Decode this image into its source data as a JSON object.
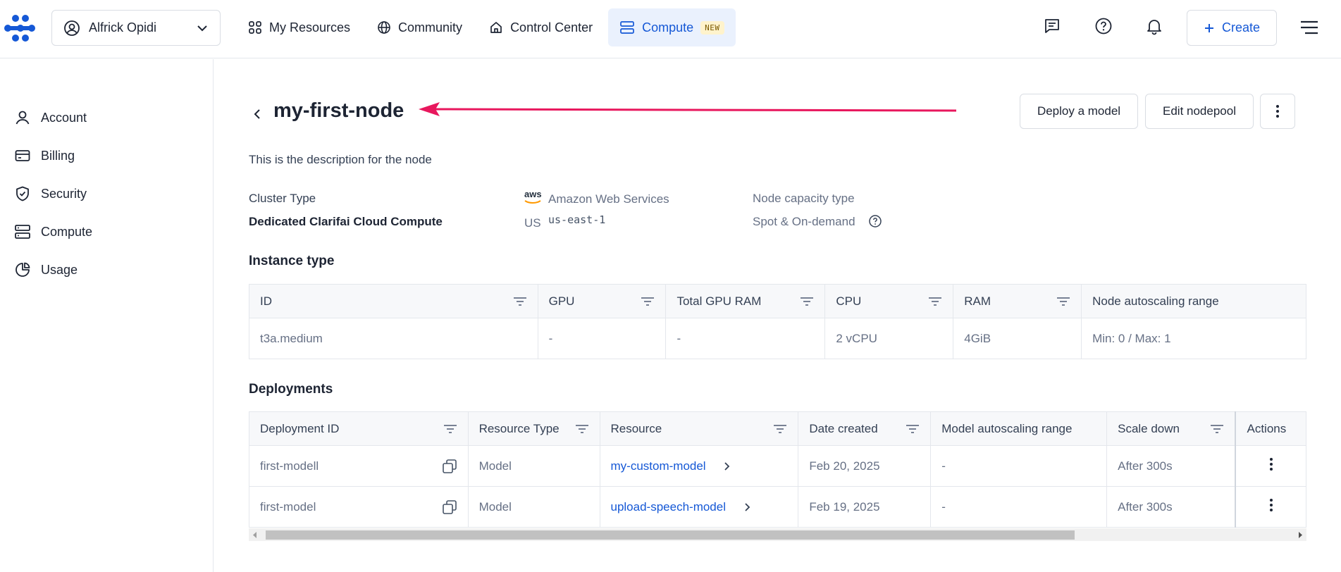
{
  "header": {
    "account_name": "Alfrick Opidi",
    "nav": [
      {
        "label": "My Resources"
      },
      {
        "label": "Community"
      },
      {
        "label": "Control Center"
      },
      {
        "label": "Compute",
        "badge": "NEW"
      }
    ],
    "create_label": "Create"
  },
  "sidebar": {
    "items": [
      {
        "label": "Account",
        "icon": "user-icon"
      },
      {
        "label": "Billing",
        "icon": "credit-card-icon"
      },
      {
        "label": "Security",
        "icon": "shield-icon"
      },
      {
        "label": "Compute",
        "icon": "server-icon"
      },
      {
        "label": "Usage",
        "icon": "pie-chart-icon"
      }
    ]
  },
  "page": {
    "title": "my-first-node",
    "description": "This is the description for the node",
    "buttons": {
      "deploy": "Deploy a model",
      "edit": "Edit nodepool"
    }
  },
  "info": {
    "cluster_type_label": "Cluster Type",
    "cluster_type_value": "Dedicated Clarifai Cloud Compute",
    "provider_logo_text": "aws",
    "provider_name": "Amazon Web Services",
    "region_flag": "US",
    "region_code": "us-east-1",
    "capacity_label": "Node capacity type",
    "capacity_value": "Spot & On-demand"
  },
  "instance": {
    "title": "Instance type",
    "columns": [
      "ID",
      "GPU",
      "Total GPU RAM",
      "CPU",
      "RAM",
      "Node autoscaling range"
    ],
    "row": [
      "t3a.medium",
      "-",
      "-",
      "2 vCPU",
      "4GiB",
      "Min: 0 / Max: 1"
    ]
  },
  "deployments": {
    "title": "Deployments",
    "columns": [
      "Deployment ID",
      "Resource Type",
      "Resource",
      "Date created",
      "Model autoscaling range",
      "Scale down",
      "Actions"
    ],
    "rows": [
      {
        "id": "first-modell",
        "type": "Model",
        "resource": "my-custom-model",
        "date": "Feb 20, 2025",
        "range": "-",
        "scale": "After 300s"
      },
      {
        "id": "first-model",
        "type": "Model",
        "resource": "upload-speech-model",
        "date": "Feb 19, 2025",
        "range": "-",
        "scale": "After 300s"
      }
    ]
  },
  "colors": {
    "accent": "#1558d6",
    "annotation_arrow": "#e8175d"
  }
}
